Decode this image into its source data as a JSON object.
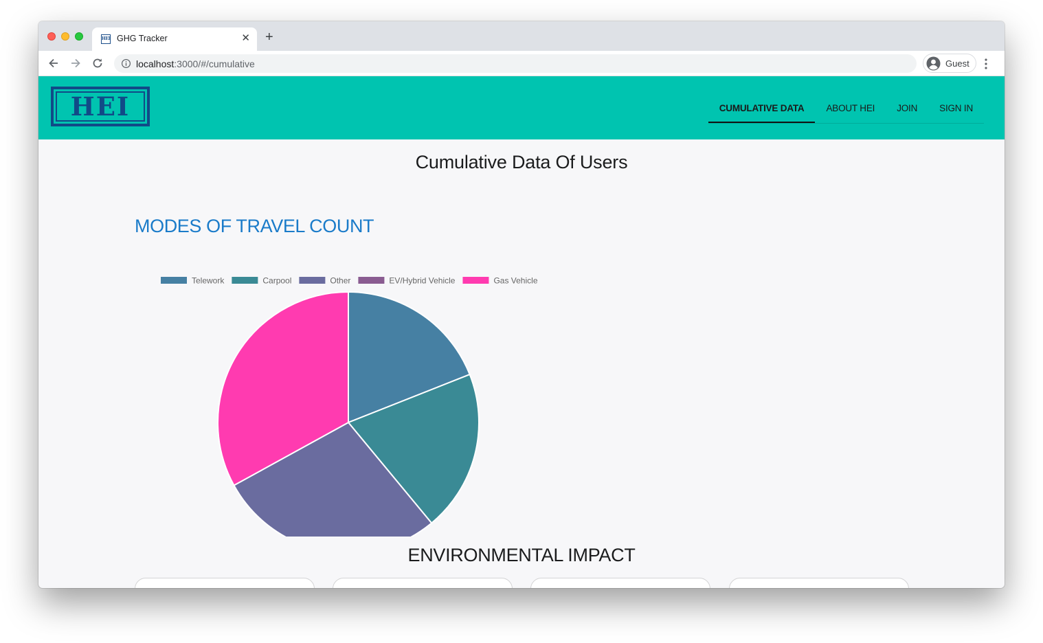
{
  "browser": {
    "tab_title": "GHG Tracker",
    "tab_favicon_text": "HEI",
    "url_host": "localhost",
    "url_rest": ":3000/#/cumulative",
    "profile_label": "Guest"
  },
  "navbar": {
    "logo_text": "HEI",
    "items": [
      {
        "label": "CUMULATIVE DATA",
        "active": true
      },
      {
        "label": "ABOUT HEI",
        "active": false
      },
      {
        "label": "JOIN",
        "active": false
      },
      {
        "label": "SIGN IN",
        "active": false
      }
    ]
  },
  "main": {
    "title": "Cumulative Data Of Users",
    "chart_heading": "MODES OF TRAVEL COUNT",
    "env_heading": "ENVIRONMENTAL IMPACT"
  },
  "chart_data": {
    "type": "pie",
    "title": "",
    "legend_position": "top",
    "categories": [
      "Telework",
      "Carpool",
      "Other",
      "EV/Hybrid Vehicle",
      "Gas Vehicle"
    ],
    "values": [
      19,
      20,
      28,
      0,
      33
    ],
    "colors": [
      "#4680a3",
      "#3a8a95",
      "#6a6c9f",
      "#8a5c91",
      "#ff3bb0"
    ]
  }
}
